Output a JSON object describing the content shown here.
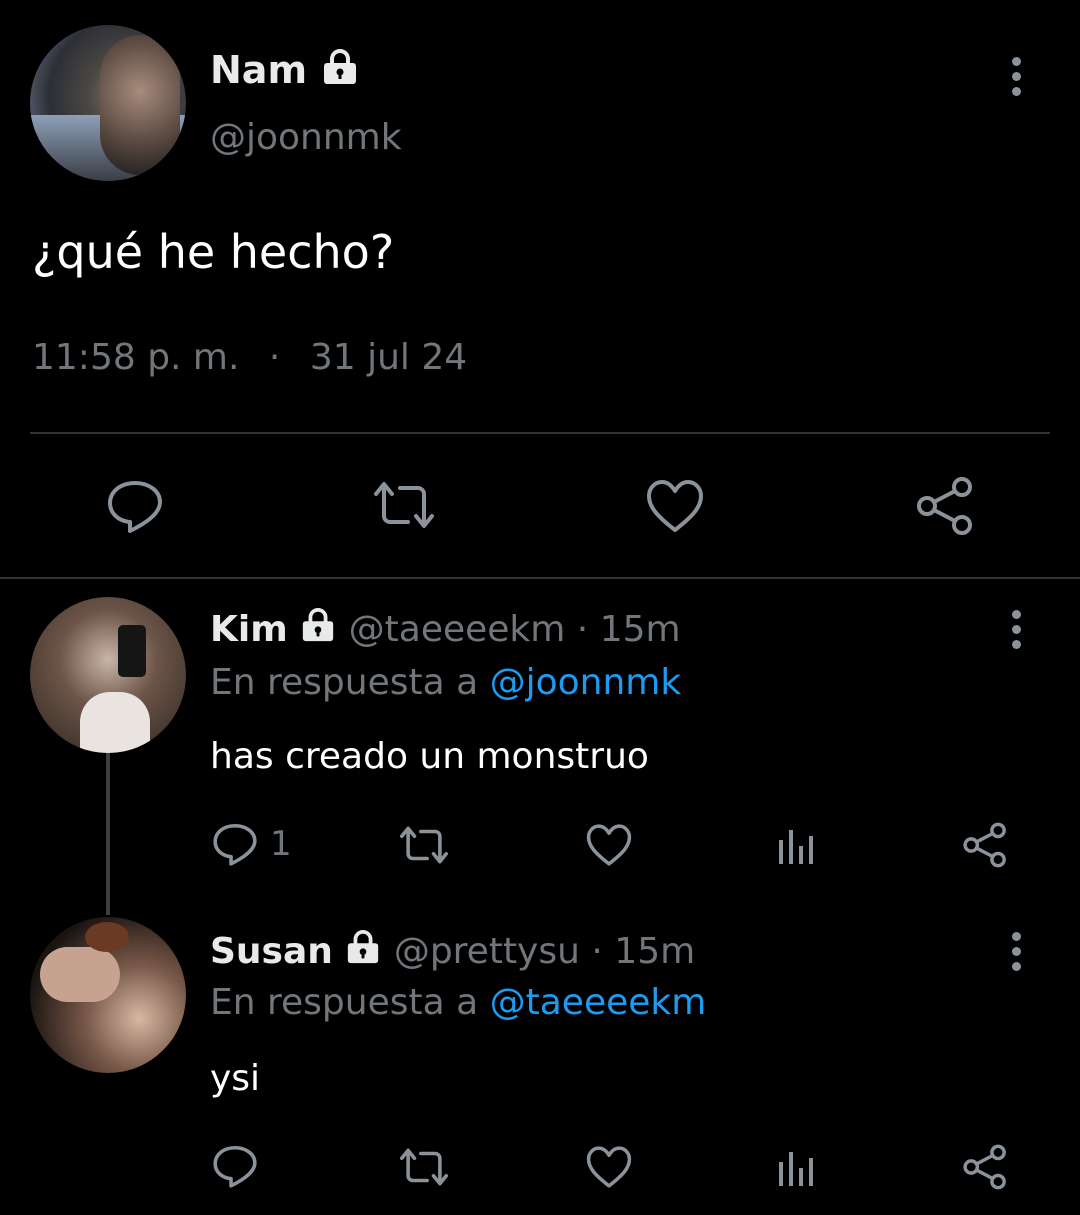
{
  "main_tweet": {
    "display_name": "Nam",
    "handle": "@joonnmk",
    "text": "¿qué he hecho?",
    "time": "11:58 p. m.",
    "separator": "·",
    "date": "31 jul 24"
  },
  "replies": [
    {
      "display_name": "Kim",
      "handle": "@taeeeekm",
      "sep": "·",
      "age": "15m",
      "reply_prefix": "En respuesta a",
      "reply_to": "@joonnmk",
      "text": "has creado un monstruo",
      "reply_count": "1"
    },
    {
      "display_name": "Susan",
      "handle": "@prettysu",
      "sep": "·",
      "age": "15m",
      "reply_prefix": "En respuesta a",
      "reply_to": "@taeeeekm",
      "text": "ysi",
      "reply_count": ""
    }
  ],
  "colors": {
    "background": "#000000",
    "text": "#e7e9ea",
    "muted": "#71767b",
    "link": "#1d9bf0",
    "divider": "#2f3336"
  }
}
